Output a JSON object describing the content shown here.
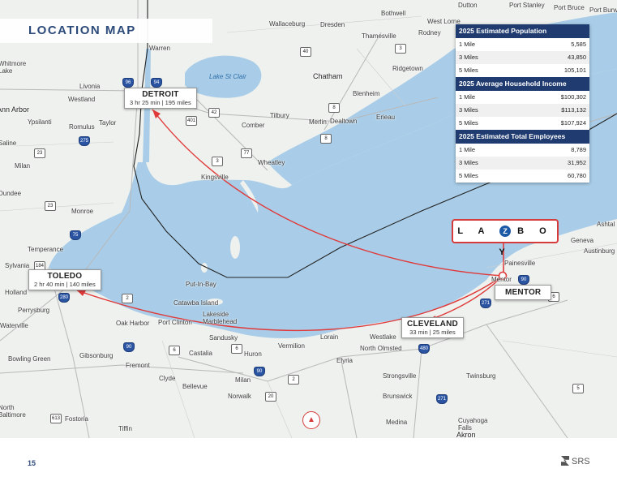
{
  "title": "LOCATION MAP",
  "page_number": "15",
  "brand": "SRS",
  "tenant_logo": "LAZBOY",
  "site": {
    "label": "MENTOR"
  },
  "callouts": {
    "detroit": {
      "name": "DETROIT",
      "drive": "3 hr 25 min | 195 miles"
    },
    "toledo": {
      "name": "TOLEDO",
      "drive": "2 hr 40 min | 140 miles"
    },
    "cleveland": {
      "name": "CLEVELAND",
      "drive": "33 min | 25 miles"
    }
  },
  "stats": {
    "population": {
      "header": "2025 Estimated Population",
      "rows": [
        {
          "label": "1 Mile",
          "value": "5,585"
        },
        {
          "label": "3 Miles",
          "value": "43,850"
        },
        {
          "label": "5 Miles",
          "value": "105,101"
        }
      ]
    },
    "income": {
      "header": "2025 Average Household Income",
      "rows": [
        {
          "label": "1 Mile",
          "value": "$100,302"
        },
        {
          "label": "3 Miles",
          "value": "$113,132"
        },
        {
          "label": "5 Miles",
          "value": "$107,924"
        }
      ]
    },
    "employees": {
      "header": "2025 Estimated Total Employees",
      "rows": [
        {
          "label": "1 Mile",
          "value": "8,789"
        },
        {
          "label": "3 Miles",
          "value": "31,952"
        },
        {
          "label": "5 Miles",
          "value": "60,780"
        }
      ]
    }
  },
  "places": {
    "whitmore_lake": "Whitmore\nLake",
    "livonia": "Livonia",
    "westland": "Westland",
    "ann_arbor": "Ann Arbor",
    "ypsilanti": "Ypsilanti",
    "romulus": "Romulus",
    "taylor": "Taylor",
    "saline": "Saline",
    "milan": "Milan",
    "dundee": "Dundee",
    "monroe": "Monroe",
    "temperance": "Temperance",
    "sylvania": "Sylvania",
    "holland": "Holland",
    "perrysburg": "Perrysburg",
    "waterville": "Waterville",
    "bowling_green": "Bowling Green",
    "gibsonburg": "Gibsonburg",
    "fremont": "Fremont",
    "clyde": "Clyde",
    "bellevue": "Bellevue",
    "norwalk": "Norwalk",
    "milan_oh": "Milan",
    "north_baltimore": "North\nBaltimore",
    "fostoria": "Fostoria",
    "tiffin": "Tiffin",
    "oak_harbor": "Oak Harbor",
    "port_clinton": "Port Clinton",
    "put_in_bay": "Put-In-Bay",
    "catawba_island": "Catawba Island",
    "lakeside_marblehead": "Lakeside\nMarblehead",
    "sandusky": "Sandusky",
    "castalia": "Castalia",
    "huron": "Huron",
    "vermilion": "Vermilion",
    "lorain": "Lorain",
    "elyria": "Elyria",
    "westlake": "Westlake",
    "north_olmsted": "North Olmsted",
    "strongsville": "Strongsville",
    "brunswick": "Brunswick",
    "medina": "Medina",
    "twinsburg": "Twinsburg",
    "cuyahoga_falls": "Cuyahoga\nFalls",
    "akron": "Akron",
    "painesville": "Painesville",
    "mentor_town": "Mentor",
    "geneva": "Geneva",
    "austinburg": "Austinburg",
    "ashtabula": "Ashtal",
    "chatham": "Chatham",
    "dresden": "Dresden",
    "wallaceburg": "Wallaceburg",
    "thamesville": "Thamesville",
    "bothwell": "Bothwell",
    "west_lorne": "West Lorne",
    "dutton": "Dutton",
    "rodney": "Rodney",
    "ridgetown": "Ridgetown",
    "blenheim": "Blenheim",
    "erieau": "Erieau",
    "merlin": "Merlin",
    "dealtown": "Dealtown",
    "tilbury": "Tilbury",
    "comber": "Comber",
    "wheatley": "Wheatley",
    "kingsville": "Kingsville",
    "port_stanley": "Port Stanley",
    "port_bruce": "Port Bruce",
    "port_burwell": "Port Burw",
    "lake_st_clair": "Lake St Clair",
    "warren": "Warren"
  },
  "colors": {
    "water": "#a9cde8",
    "land": "#eef1ee",
    "route": "#e03a3a",
    "border": "#222222",
    "header_bg": "#1f3b6f"
  }
}
